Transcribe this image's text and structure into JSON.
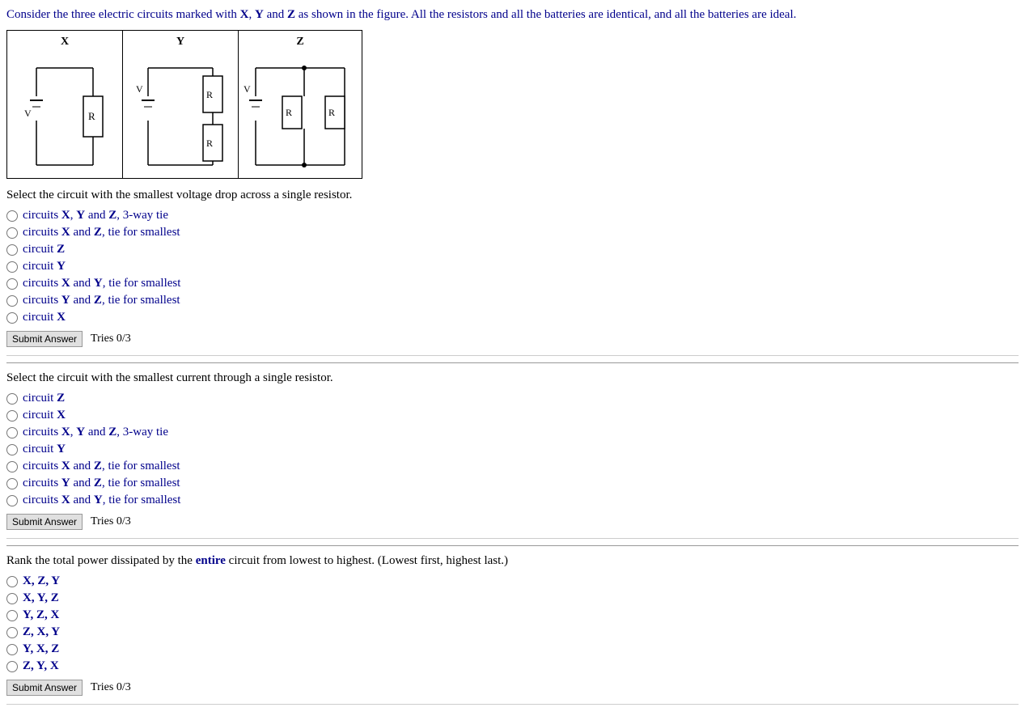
{
  "intro": {
    "text": "Consider the three electric circuits marked with X, Y and Z as shown in the figure. All the resistors and all the batteries are identical, and all the batteries are ideal."
  },
  "circuits": [
    {
      "label": "X"
    },
    {
      "label": "Y"
    },
    {
      "label": "Z"
    }
  ],
  "q1": {
    "text": "Select the circuit with the smallest voltage drop across a single resistor.",
    "options": [
      {
        "id": "q1a",
        "text_before": "circuits ",
        "bold": "X, Y",
        "text_mid": " and ",
        "bold2": "Z",
        "text_after": ", 3-way tie"
      },
      {
        "id": "q1b",
        "text_before": "circuits ",
        "bold": "X",
        "text_mid": " and ",
        "bold2": "Z",
        "text_after": ", tie for smallest"
      },
      {
        "id": "q1c",
        "text_before": "circuit ",
        "bold": "Z",
        "text_mid": "",
        "bold2": "",
        "text_after": ""
      },
      {
        "id": "q1d",
        "text_before": "circuit ",
        "bold": "Y",
        "text_mid": "",
        "bold2": "",
        "text_after": ""
      },
      {
        "id": "q1e",
        "text_before": "circuits ",
        "bold": "X",
        "text_mid": " and ",
        "bold2": "Y",
        "text_after": ", tie for smallest"
      },
      {
        "id": "q1f",
        "text_before": "circuits ",
        "bold": "Y",
        "text_mid": " and ",
        "bold2": "Z",
        "text_after": ", tie for smallest"
      },
      {
        "id": "q1g",
        "text_before": "circuit ",
        "bold": "X",
        "text_mid": "",
        "bold2": "",
        "text_after": ""
      }
    ],
    "submit": "Submit Answer",
    "tries": "Tries 0/3"
  },
  "q2": {
    "text": "Select the circuit with the smallest current through a single resistor.",
    "options": [
      {
        "id": "q2a",
        "text_before": "circuit ",
        "bold": "Z",
        "text_mid": "",
        "bold2": "",
        "text_after": ""
      },
      {
        "id": "q2b",
        "text_before": "circuit ",
        "bold": "X",
        "text_mid": "",
        "bold2": "",
        "text_after": ""
      },
      {
        "id": "q2c",
        "text_before": "circuits ",
        "bold": "X, Y",
        "text_mid": " and ",
        "bold2": "Z",
        "text_after": ", 3-way tie"
      },
      {
        "id": "q2d",
        "text_before": "circuit ",
        "bold": "Y",
        "text_mid": "",
        "bold2": "",
        "text_after": ""
      },
      {
        "id": "q2e",
        "text_before": "circuits ",
        "bold": "X",
        "text_mid": " and ",
        "bold2": "Z",
        "text_after": ", tie for smallest"
      },
      {
        "id": "q2f",
        "text_before": "circuits ",
        "bold": "Y",
        "text_mid": " and ",
        "bold2": "Z",
        "text_after": ", tie for smallest"
      },
      {
        "id": "q2g",
        "text_before": "circuits ",
        "bold": "X",
        "text_mid": " and ",
        "bold2": "Y",
        "text_after": ", tie for smallest"
      }
    ],
    "submit": "Submit Answer",
    "tries": "Tries 0/3"
  },
  "q3": {
    "text_before": "Rank the total power dissipated by the ",
    "bold": "entire",
    "text_after": " circuit from lowest to highest. (Lowest first, highest last.)",
    "options": [
      {
        "id": "q3a",
        "text": "X, Z, Y"
      },
      {
        "id": "q3b",
        "text": "X, Y, Z"
      },
      {
        "id": "q3c",
        "text": "Y, Z, X"
      },
      {
        "id": "q3d",
        "text": "Z, X, Y"
      },
      {
        "id": "q3e",
        "text": "Y, X, Z"
      },
      {
        "id": "q3f",
        "text": "Z, Y, X"
      }
    ],
    "submit": "Submit Answer",
    "tries": "Tries 0/3"
  }
}
